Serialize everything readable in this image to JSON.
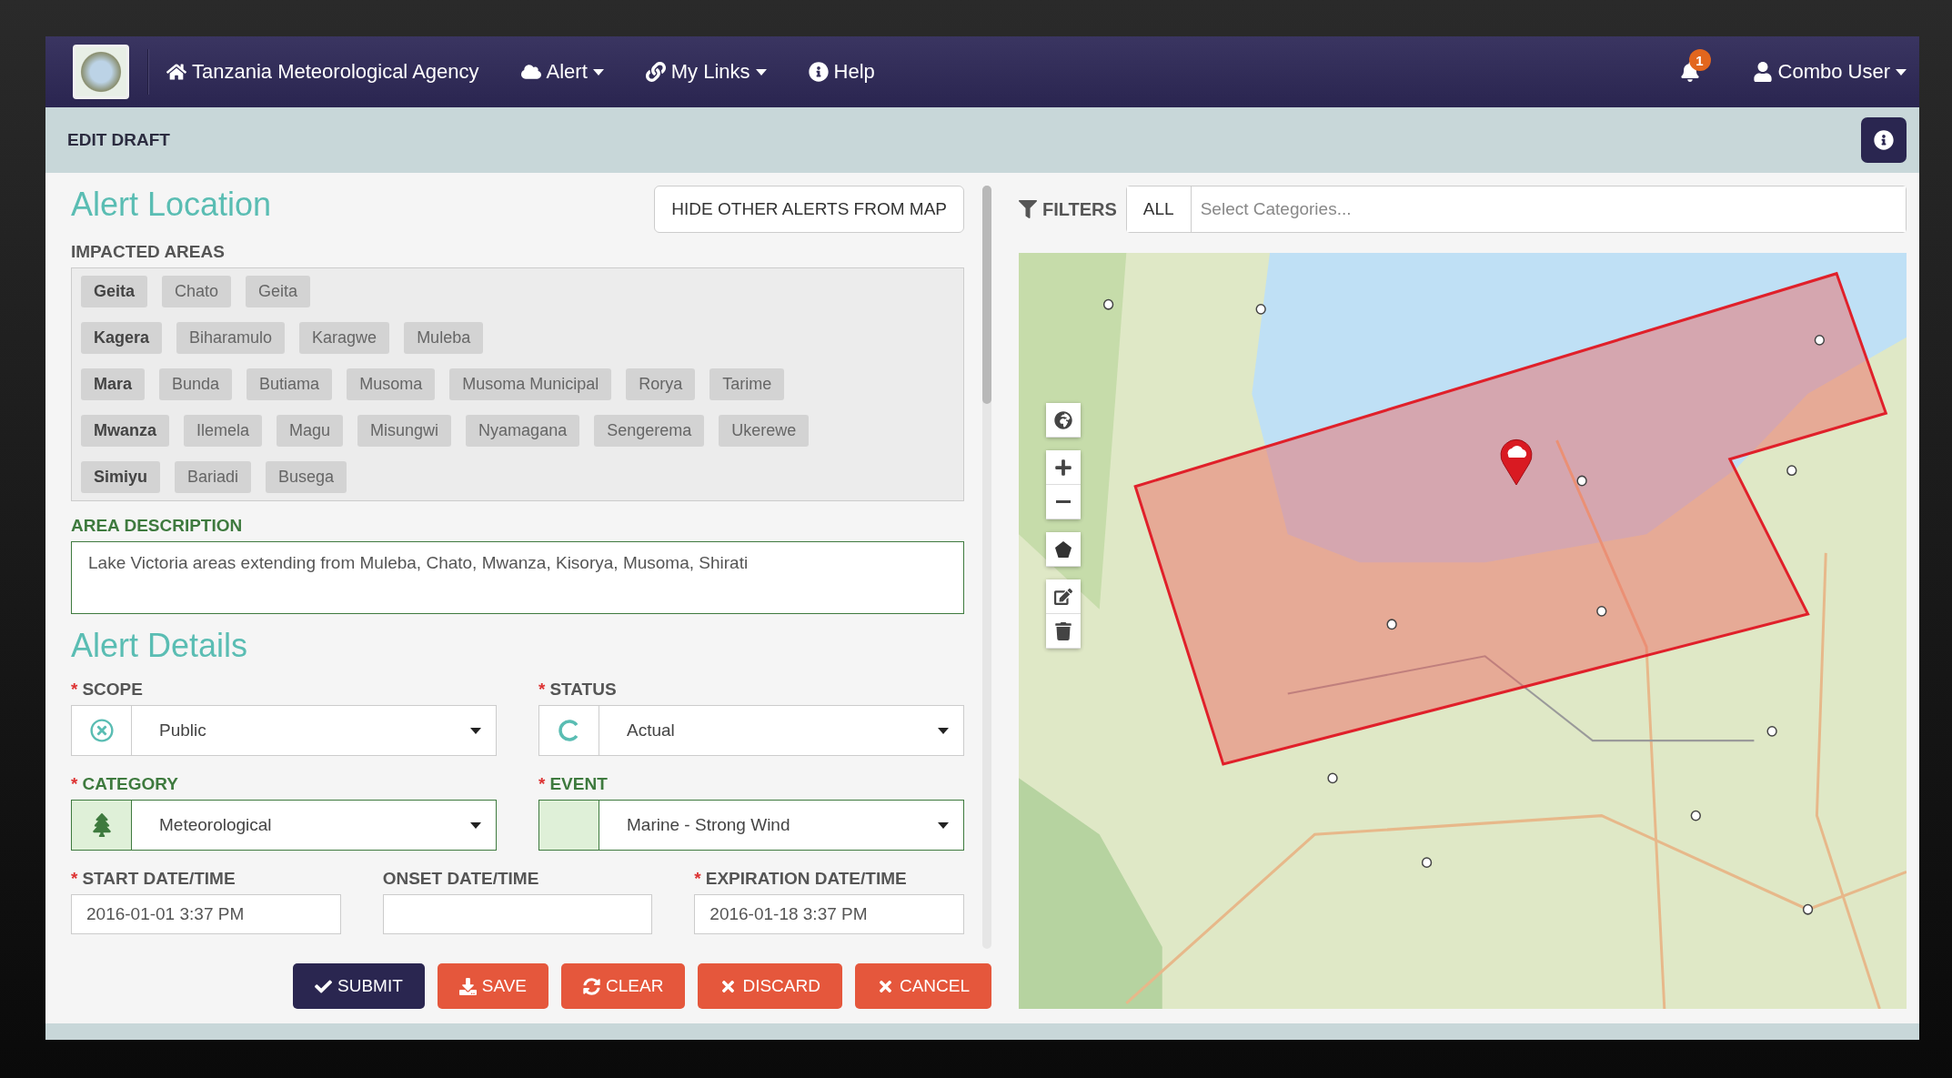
{
  "nav": {
    "brand": "Tanzania Meteorological Agency",
    "items": [
      {
        "label": "Alert",
        "kind": "cloud",
        "dropdown": true
      },
      {
        "label": "My Links",
        "kind": "link",
        "dropdown": true
      },
      {
        "label": "Help",
        "kind": "info",
        "dropdown": false
      }
    ],
    "notification_count": "1",
    "user": "Combo User"
  },
  "page_title": "EDIT DRAFT",
  "location": {
    "title": "Alert Location",
    "hide_button": "HIDE OTHER ALERTS FROM MAP",
    "impacted_label": "IMPACTED AREAS",
    "regions": [
      {
        "name": "Geita",
        "districts": [
          "Chato",
          "Geita"
        ]
      },
      {
        "name": "Kagera",
        "districts": [
          "Biharamulo",
          "Karagwe",
          "Muleba"
        ]
      },
      {
        "name": "Mara",
        "districts": [
          "Bunda",
          "Butiama",
          "Musoma",
          "Musoma Municipal",
          "Rorya",
          "Tarime"
        ]
      },
      {
        "name": "Mwanza",
        "districts": [
          "Ilemela",
          "Magu",
          "Misungwi",
          "Nyamagana",
          "Sengerema",
          "Ukerewe"
        ]
      },
      {
        "name": "Simiyu",
        "districts": [
          "Bariadi",
          "Busega"
        ]
      }
    ],
    "area_label": "AREA DESCRIPTION",
    "area_description": "Lake Victoria areas extending from Muleba, Chato, Mwanza, Kisorya, Musoma, Shirati"
  },
  "details": {
    "title": "Alert Details",
    "required_mark": "*",
    "selects": [
      {
        "label": "SCOPE",
        "required": true,
        "valid": false,
        "kind": "scope",
        "value": "Public"
      },
      {
        "label": "STATUS",
        "required": true,
        "valid": false,
        "kind": "status",
        "value": "Actual"
      },
      {
        "label": "CATEGORY",
        "required": true,
        "valid": true,
        "kind": "category",
        "value": "Meteorological"
      },
      {
        "label": "EVENT",
        "required": true,
        "valid": true,
        "kind": "event",
        "value": "Marine - Strong Wind"
      }
    ],
    "dates": [
      {
        "label": "START DATE/TIME",
        "required": true,
        "value": "2016-01-01 3:37 PM"
      },
      {
        "label": "ONSET DATE/TIME",
        "required": false
      },
      {
        "label": "EXPIRATION DATE/TIME",
        "required": true,
        "value": "2016-01-18 3:37 PM"
      }
    ]
  },
  "actions": [
    {
      "label": "SUBMIT",
      "kind": "submit"
    },
    {
      "label": "SAVE",
      "kind": "save"
    },
    {
      "label": "CLEAR",
      "kind": "clear"
    },
    {
      "label": "DISCARD",
      "kind": "discard"
    },
    {
      "label": "CANCEL",
      "kind": "cancel"
    }
  ],
  "filters": {
    "label": "FILTERS",
    "all": "ALL",
    "placeholder": "Select Categories..."
  }
}
